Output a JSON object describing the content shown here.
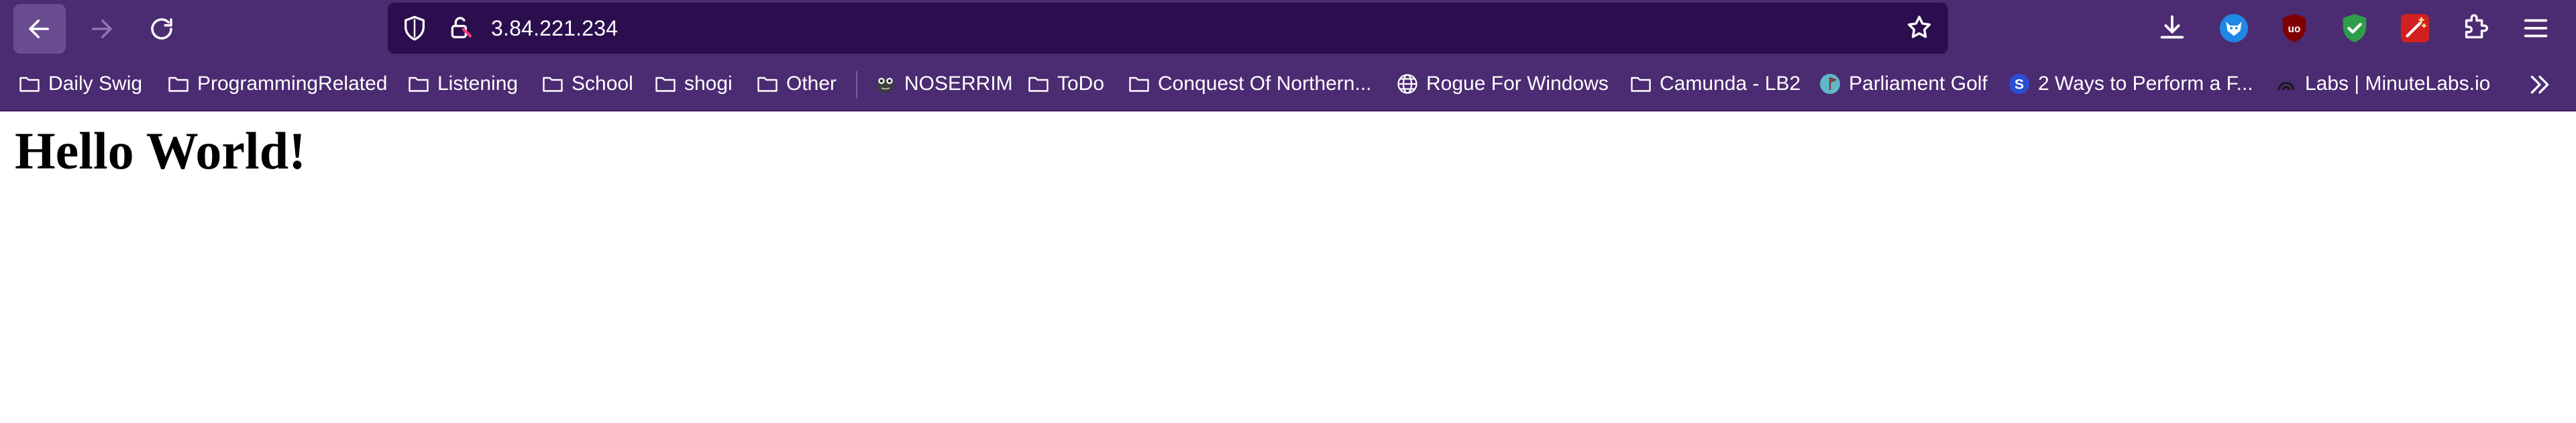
{
  "browser": {
    "address_bar": {
      "url": "3.84.221.234"
    },
    "toolbar_icons": [
      "back-arrow-icon",
      "forward-arrow-icon",
      "reload-icon",
      "shield-icon",
      "lock-icon",
      "star-icon",
      "download-icon",
      "extension-fox-icon",
      "ublock-icon",
      "shield-check-icon",
      "wand-icon",
      "puzzle-icon",
      "menu-icon"
    ],
    "bookmarks": [
      {
        "label": "Daily Swig",
        "icon": "folder-icon"
      },
      {
        "label": "ProgrammingRelated",
        "icon": "folder-icon"
      },
      {
        "label": "Listening",
        "icon": "folder-icon"
      },
      {
        "label": "School",
        "icon": "folder-icon"
      },
      {
        "label": "shogi",
        "icon": "folder-icon"
      },
      {
        "label": "Other",
        "icon": "folder-icon"
      },
      {
        "label": "NOSERRIM",
        "icon": "frog-icon"
      },
      {
        "label": "ToDo",
        "icon": "folder-icon"
      },
      {
        "label": "Conquest Of Northern...",
        "icon": "folder-icon"
      },
      {
        "label": "Rogue For Windows",
        "icon": "globe-icon"
      },
      {
        "label": "Camunda - LB2",
        "icon": "folder-icon"
      },
      {
        "label": "Parliament Golf",
        "icon": "parliament-golf-icon"
      },
      {
        "label": "2 Ways to Perform a F...",
        "icon": "s-logo-icon"
      },
      {
        "label": "Labs | MinuteLabs.io",
        "icon": "minutelabs-icon"
      }
    ]
  },
  "page": {
    "heading": "Hello World!"
  },
  "colors": {
    "toolbar_bg": "#4b2b72",
    "urlbar_bg": "#2c0e4e",
    "page_bg": "#ffffff"
  }
}
